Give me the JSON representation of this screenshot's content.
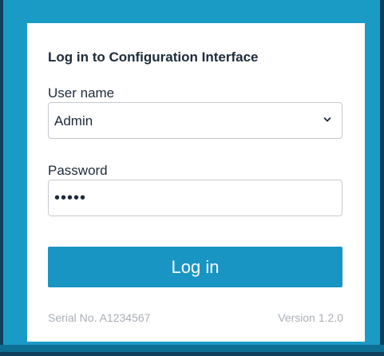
{
  "login": {
    "title": "Log in to Configuration Interface",
    "username_label": "User name",
    "username_value": "Admin",
    "password_label": "Password",
    "password_value": "•••••",
    "login_button_label": "Log in"
  },
  "footer": {
    "serial": "Serial No. A1234567",
    "version": "Version 1.2.0"
  },
  "icons": {
    "select_arrow": "chevron-down-icon"
  },
  "colors": {
    "background": "#1a9bc6",
    "button": "#1995c3",
    "card": "#ffffff",
    "footer_text": "#a9afb6"
  }
}
